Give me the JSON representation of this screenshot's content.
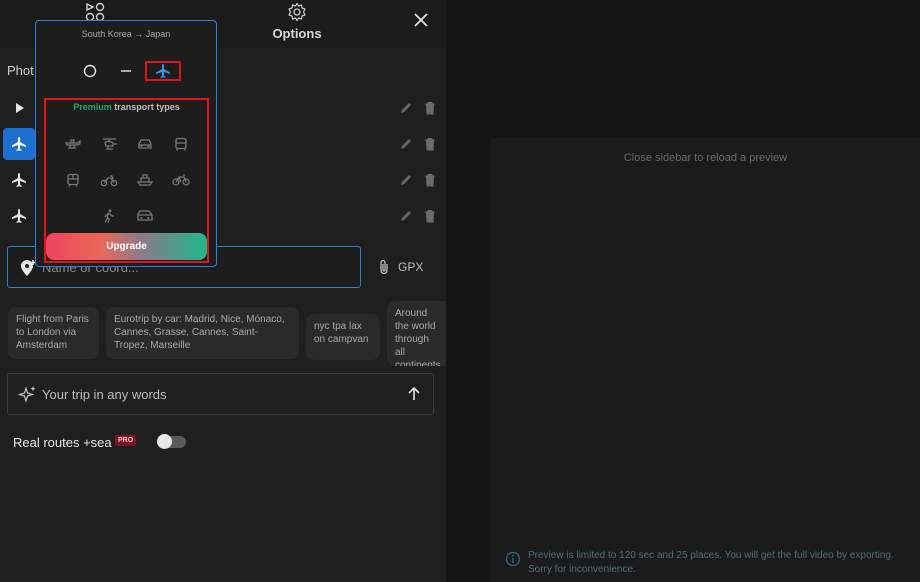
{
  "tabs": {
    "routes_icon": "shapes-icon",
    "options_label": "Options"
  },
  "photo_label": "Phot",
  "route_rows": [
    {
      "icon": "play-icon",
      "active": false
    },
    {
      "icon": "plane-icon",
      "active": true
    },
    {
      "icon": "plane-icon",
      "active": false
    },
    {
      "icon": "plane-icon",
      "active": false
    }
  ],
  "popup": {
    "route_title": "South Korea → Japan",
    "modes": [
      "circle-icon",
      "dash-icon",
      "plane-icon"
    ],
    "selected_mode": "plane-icon",
    "premium_header_green": "Premium",
    "premium_header_rest": " transport types",
    "transport_types": [
      "seaplane-icon",
      "helicopter-icon",
      "car-icon",
      "bus-icon",
      "tram-icon",
      "motorcycle-icon",
      "ferry-icon",
      "bicycle-icon",
      "walking-icon",
      "campervan-icon"
    ],
    "upgrade_label": "Upgrade"
  },
  "search": {
    "placeholder": "Name or coord...",
    "gpx_label": "GPX"
  },
  "suggestions": [
    "Flight from Paris to London via Amsterdam",
    "Eurotrip by car: Madrid, Nice, Mónaco, Cannes, Grasse, Cannes, Saint-Tropez, Marseille",
    "nyc tpa lax on campvan",
    "Around the world through all continents by seaplane"
  ],
  "ai_input": {
    "placeholder": "Your trip in any words"
  },
  "real_routes": {
    "label": "Real routes +sea",
    "badge": "PRO",
    "enabled": false
  },
  "preview": {
    "message": "Close sidebar to reload a preview",
    "note": "Preview is limited to 120 sec and 25 places. You will get the full video by exporting. Sorry for inconvenience."
  },
  "colors": {
    "accent": "#2f7fd8",
    "highlight": "#e0121b",
    "premium_green": "#25a36f",
    "pro_badge": "#7a1426"
  }
}
